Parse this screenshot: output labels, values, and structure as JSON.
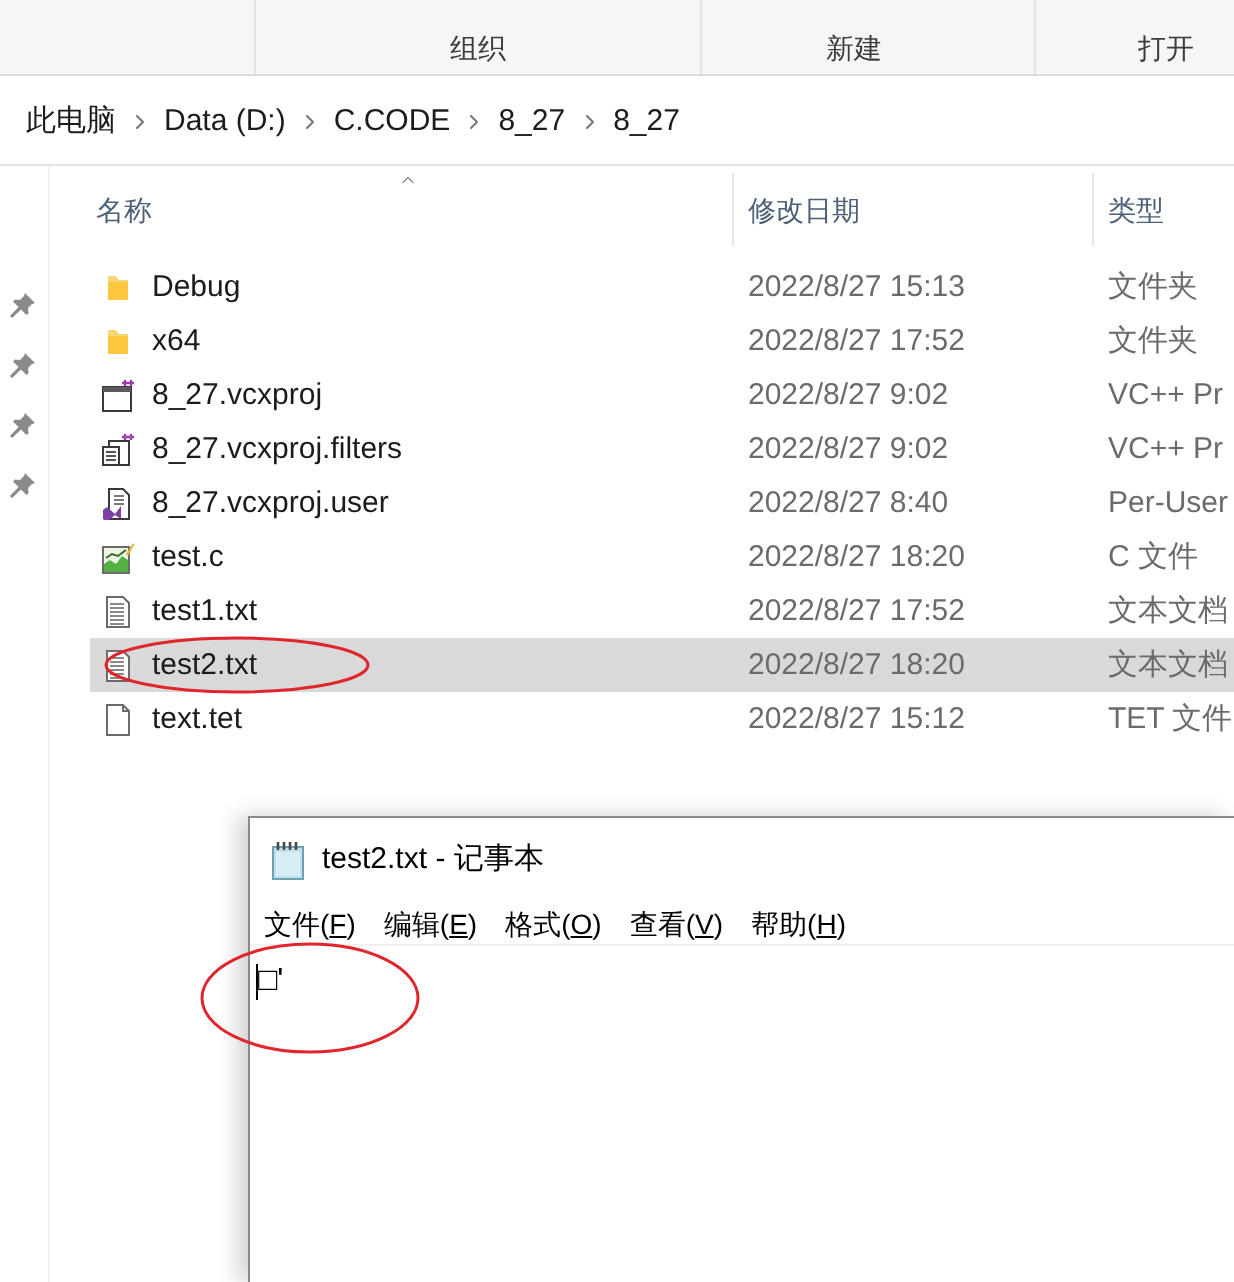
{
  "ribbon": {
    "groups": [
      "组织",
      "新建",
      "打开"
    ]
  },
  "breadcrumb": [
    "此电脑",
    "Data (D:)",
    "C.CODE",
    "8_27",
    "8_27"
  ],
  "nav_pane": {
    "pins": [
      {
        "pinned": true
      },
      {
        "pinned": true
      },
      {
        "pinned": true
      },
      {
        "pinned": true
      }
    ]
  },
  "file_list": {
    "columns": [
      "名称",
      "修改日期",
      "类型"
    ],
    "rows": [
      {
        "name": "Debug",
        "modified": "2022/8/27 15:13",
        "type": "文件夹",
        "kind": "folder",
        "selected": false,
        "annotated": false
      },
      {
        "name": "x64",
        "modified": "2022/8/27 17:52",
        "type": "文件夹",
        "kind": "folder",
        "selected": false,
        "annotated": false
      },
      {
        "name": "8_27.vcxproj",
        "modified": "2022/8/27 9:02",
        "type": "VC++ Pr",
        "kind": "project",
        "selected": false,
        "annotated": false
      },
      {
        "name": "8_27.vcxproj.filters",
        "modified": "2022/8/27 9:02",
        "type": "VC++ Pr",
        "kind": "filters",
        "selected": false,
        "annotated": false
      },
      {
        "name": "8_27.vcxproj.user",
        "modified": "2022/8/27 8:40",
        "type": "Per-User",
        "kind": "user",
        "selected": false,
        "annotated": false
      },
      {
        "name": "test.c",
        "modified": "2022/8/27 18:20",
        "type": "C 文件",
        "kind": "source",
        "selected": false,
        "annotated": false
      },
      {
        "name": "test1.txt",
        "modified": "2022/8/27 17:52",
        "type": "文本文档",
        "kind": "text",
        "selected": false,
        "annotated": false
      },
      {
        "name": "test2.txt",
        "modified": "2022/8/27 18:20",
        "type": "文本文档",
        "kind": "text",
        "selected": true,
        "annotated": true
      },
      {
        "name": "text.tet",
        "modified": "2022/8/27 15:12",
        "type": "TET 文件",
        "kind": "blank",
        "selected": false,
        "annotated": false
      }
    ]
  },
  "notepad": {
    "title": "test2.txt - 记事本",
    "menu": [
      {
        "before": "文件(",
        "key": "F",
        "after": ")"
      },
      {
        "before": "编辑(",
        "key": "E",
        "after": ")"
      },
      {
        "before": "格式(",
        "key": "O",
        "after": ")"
      },
      {
        "before": "查看(",
        "key": "V",
        "after": ")"
      },
      {
        "before": "帮助(",
        "key": "H",
        "after": ")"
      }
    ],
    "content": "□'",
    "annotated": true
  }
}
